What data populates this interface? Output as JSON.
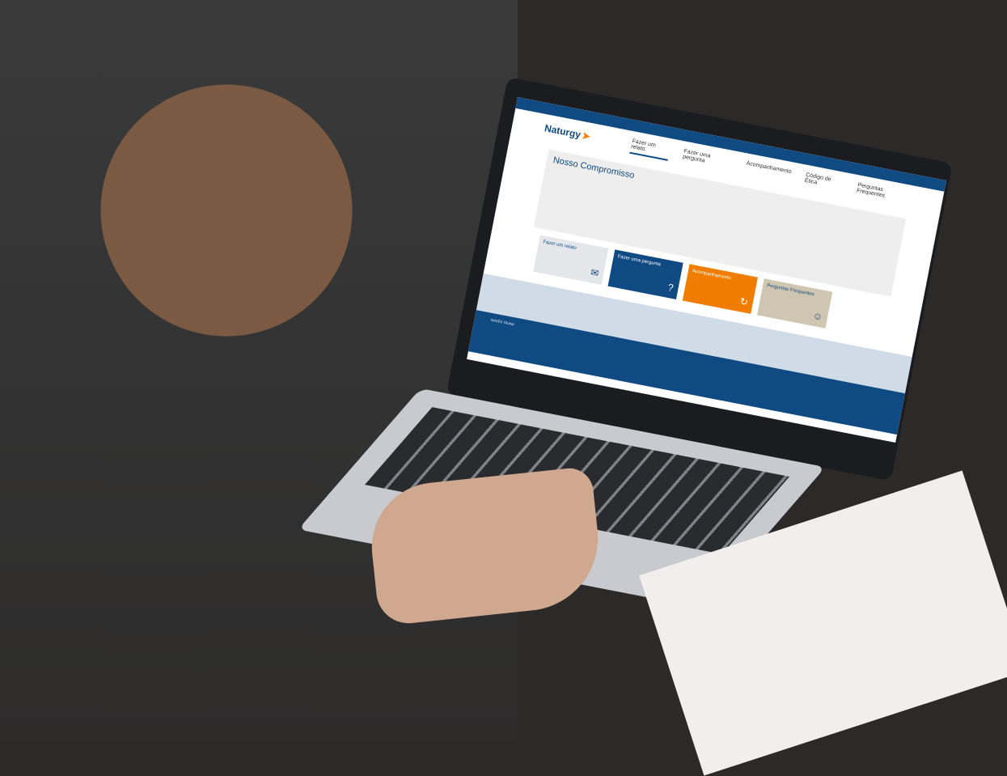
{
  "screen": {
    "logo": "Naturgy",
    "nav": [
      "Fazer um relato",
      "Fazer uma pergunta",
      "Acompanhamento",
      "Código de Ética",
      "Perguntas Frequentes"
    ],
    "heading": "Nosso Compromisso",
    "tiles": [
      {
        "label": "Fazer um relato",
        "icon": "mail-icon"
      },
      {
        "label": "Fazer uma pergunta",
        "icon": "question-icon"
      },
      {
        "label": "Acompanhamento",
        "icon": "refresh-icon"
      },
      {
        "label": "Perguntas Frequentes",
        "icon": "people-icon"
      }
    ],
    "footer": {
      "company": "NAVEX Global"
    }
  }
}
